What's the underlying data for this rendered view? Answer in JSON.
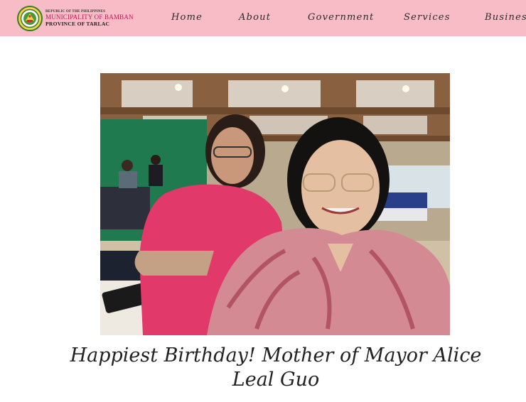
{
  "header": {
    "logo_icon": "municipal-seal-icon",
    "brand": {
      "line1": "REPUBLIC OF THE PHILIPPINES",
      "line2": "MUNICIPALITY OF BAMBAN",
      "line3": "PROVINCE OF TARLAC"
    },
    "nav": {
      "home": "Home",
      "about": "About",
      "government": "Government",
      "services": "Services",
      "business": "Business"
    },
    "background_color": "#f8bcc6",
    "brand_accent_color": "#c2185b"
  },
  "article": {
    "title": "Happiest Birthday! Mother of Mayor Alice Leal Guo"
  }
}
